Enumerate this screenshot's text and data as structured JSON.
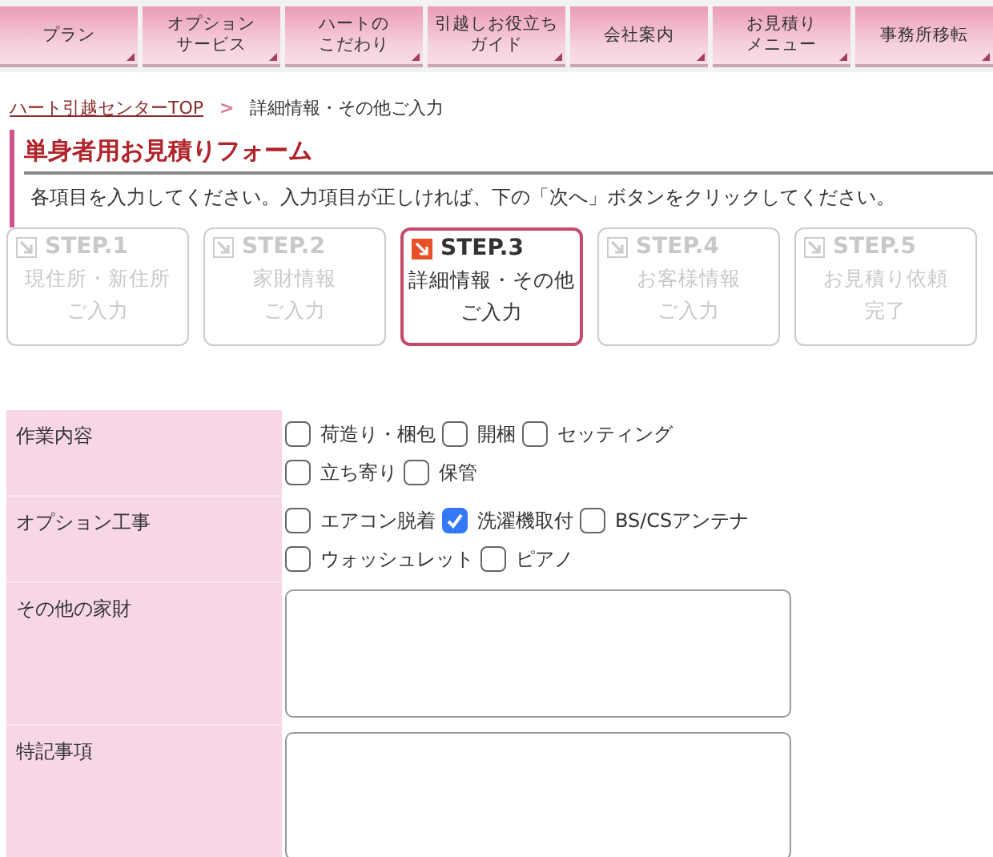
{
  "nav": [
    {
      "lines": [
        "プラン"
      ]
    },
    {
      "lines": [
        "オプション",
        "サービス"
      ]
    },
    {
      "lines": [
        "ハートの",
        "こだわり"
      ]
    },
    {
      "lines": [
        "引越しお役立ち",
        "ガイド"
      ]
    },
    {
      "lines": [
        "会社案内"
      ]
    },
    {
      "lines": [
        "お見積り",
        "メニュー"
      ]
    },
    {
      "lines": [
        "事務所移転"
      ]
    }
  ],
  "breadcrumb": {
    "link": "ハート引越センターTOP",
    "separator": ">",
    "current": "詳細情報・その他ご入力"
  },
  "heading": "単身者用お見積りフォーム",
  "description": "各項目を入力してください。入力項目が正しければ、下の「次へ」ボタンをクリックしてください。",
  "steps": [
    {
      "step": "STEP.1",
      "lines": [
        "現住所・新住所",
        "ご入力"
      ],
      "selected": false
    },
    {
      "step": "STEP.2",
      "lines": [
        "家財情報",
        "ご入力"
      ],
      "selected": false
    },
    {
      "step": "STEP.3",
      "lines": [
        "詳細情報・その他",
        "ご入力"
      ],
      "selected": true
    },
    {
      "step": "STEP.4",
      "lines": [
        "お客様情報",
        "ご入力"
      ],
      "selected": false
    },
    {
      "step": "STEP.5",
      "lines": [
        "お見積り依頼",
        "完了"
      ],
      "selected": false
    }
  ],
  "form": [
    {
      "label": "作業内容",
      "kind": "checkboxes",
      "options": [
        {
          "label": "荷造り・梱包",
          "checked": false
        },
        {
          "label": "開梱",
          "checked": false
        },
        {
          "label": "セッティング",
          "checked": false
        },
        {
          "label": "立ち寄り",
          "checked": false
        },
        {
          "label": "保管",
          "checked": false
        }
      ]
    },
    {
      "label": "オプション工事",
      "kind": "checkboxes",
      "options": [
        {
          "label": "エアコン脱着",
          "checked": false
        },
        {
          "label": "洗濯機取付",
          "checked": true
        },
        {
          "label": "BS/CSアンテナ",
          "checked": false
        },
        {
          "label": "ウォッシュレット",
          "checked": false
        },
        {
          "label": "ピアノ",
          "checked": false
        }
      ]
    },
    {
      "label": "その他の家財",
      "kind": "textarea"
    },
    {
      "label": "特記事項",
      "kind": "textarea"
    }
  ]
}
